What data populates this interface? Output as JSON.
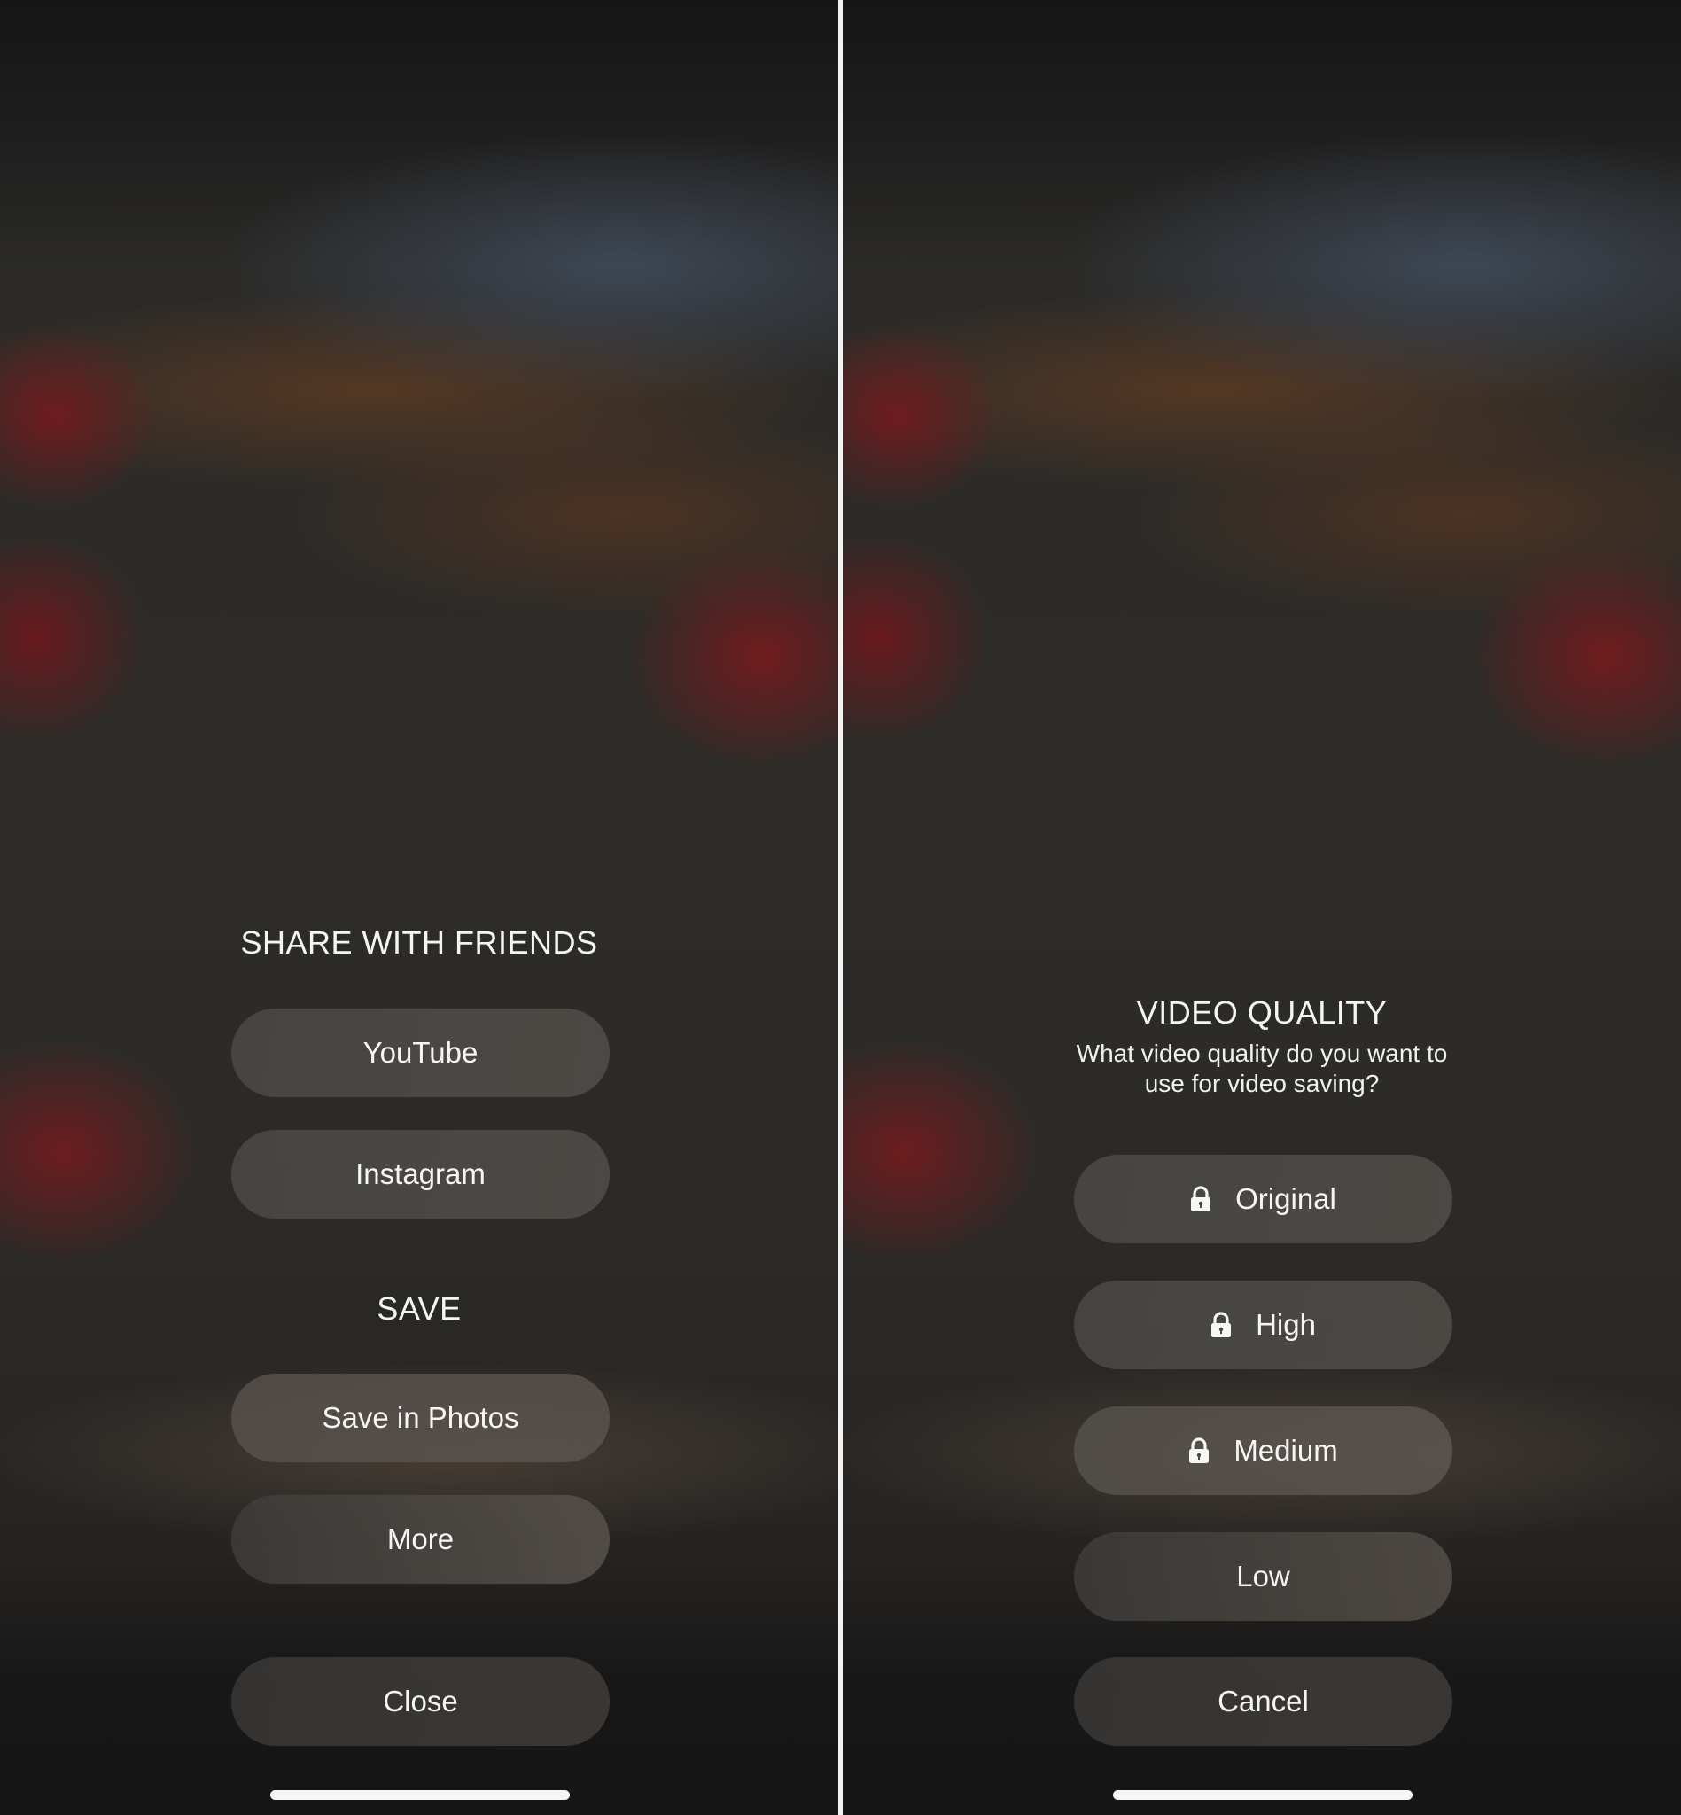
{
  "left_screen": {
    "share_heading": "SHARE WITH FRIENDS",
    "share_buttons": [
      {
        "label": "YouTube"
      },
      {
        "label": "Instagram"
      }
    ],
    "save_heading": "SAVE",
    "save_buttons": [
      {
        "label": "Save in Photos"
      },
      {
        "label": "More"
      }
    ],
    "close_label": "Close"
  },
  "right_screen": {
    "title": "VIDEO QUALITY",
    "subtitle_line1": "What video quality do you want to",
    "subtitle_line2": "use for video saving?",
    "options": [
      {
        "label": "Original",
        "locked": true,
        "icon": "lock-icon"
      },
      {
        "label": "High",
        "locked": true,
        "icon": "lock-icon"
      },
      {
        "label": "Medium",
        "locked": true,
        "icon": "lock-icon"
      },
      {
        "label": "Low",
        "locked": false
      }
    ],
    "cancel_label": "Cancel"
  },
  "colors": {
    "text": "#f5f5f3",
    "button_fill": "#4e4c4a",
    "background_dark": "#161616",
    "divider": "#f2f2f2"
  }
}
